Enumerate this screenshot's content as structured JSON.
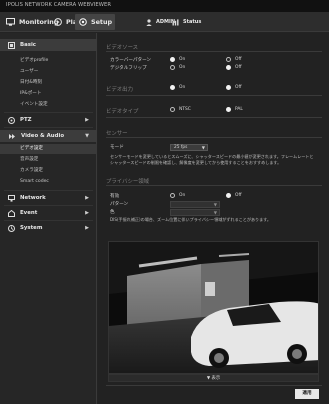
{
  "app": {
    "title": "IPOLIS NETWORK CAMERA WEBVIEWER"
  },
  "nav": {
    "monitoring": "Monitoring",
    "playback": "Playback",
    "setup": "Setup",
    "admin": "ADMIN",
    "status": "Status"
  },
  "sidebar": {
    "sections": [
      {
        "label": "Basic"
      },
      {
        "label": "PTZ"
      },
      {
        "label": "Video & Audio"
      },
      {
        "label": "Network"
      },
      {
        "label": "Event"
      },
      {
        "label": "System"
      }
    ],
    "basic_items": [
      "ビデオprofile",
      "ユーザー",
      "日付&時刻",
      "IP&ポート",
      "イベント設定"
    ],
    "video_items": [
      "ビデオ設定",
      "音声設定",
      "カメラ設定",
      "Smart codec"
    ],
    "active_item": "ビデオ設定"
  },
  "main": {
    "video_source": {
      "heading": "ビデオソース",
      "rows": [
        {
          "label": "カラーバーパターン",
          "opt_on": "On",
          "opt_off": "Off",
          "selected": "On"
        },
        {
          "label": "デジタルフリップ",
          "opt_on": "On",
          "opt_off": "Off",
          "selected": "Off"
        }
      ]
    },
    "video_output": {
      "heading": "ビデオ出力",
      "opt_on": "On",
      "opt_off": "Off"
    },
    "video_type": {
      "heading": "ビデオタイプ",
      "opt_a": "NTSC",
      "opt_b": "PAL",
      "selected": "PAL"
    },
    "sensor": {
      "heading": "センサー",
      "mode_label": "モード",
      "mode_value": "25 fps",
      "note": "センサーモードを変更しているとスムーズに、シャッタースピードの最小値が変更されます。フレームレートとシャッタースピードの制限を確認し、解像度を変更してから使用することをおすすめします。"
    },
    "privacy": {
      "heading": "プライバシー領域",
      "enable_label": "有効",
      "opt_on": "On",
      "opt_off": "Off",
      "selected": "Off",
      "pattern_label": "パターン",
      "color_label": "色",
      "note": "DIS(手振れ補正)の場合、ズーム位置に伴いプライバシー領域がずれることがあります。"
    },
    "preview": {
      "footer_label": "表示"
    },
    "apply_label": "適用"
  },
  "colors": {
    "background": "#232323",
    "panel": "#222222",
    "sidebar": "#262626",
    "active_item": "#3a3a3a",
    "apply_button": "#e8e8e8"
  }
}
